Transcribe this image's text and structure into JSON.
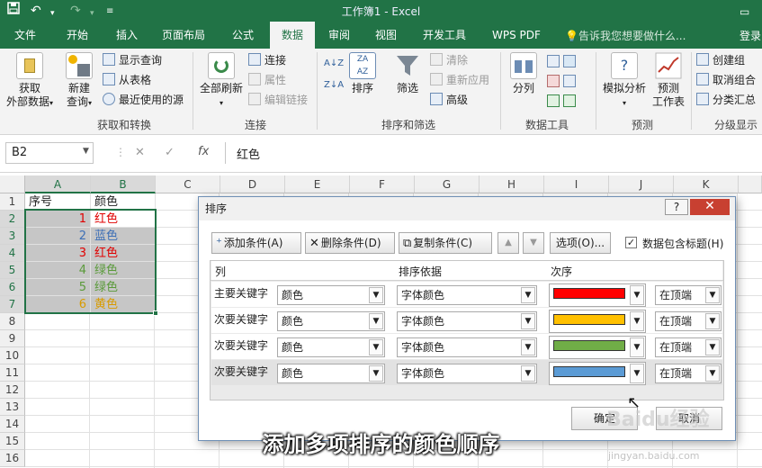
{
  "titlebar": {
    "save_icon": "save-icon",
    "undo_icon": "undo-icon",
    "redo_icon": "redo-icon",
    "qa_menu_icon": "customize-icon",
    "title": "工作簿1 - Excel"
  },
  "tabs": [
    "文件",
    "开始",
    "插入",
    "页面布局",
    "公式",
    "数据",
    "审阅",
    "视图",
    "开发工具",
    "WPS PDF"
  ],
  "active_tab": "数据",
  "tellme": "告诉我您想要做什么...",
  "login": "登录",
  "ribbon": {
    "get_external": "获取\n外部数据",
    "new_query": "新建\n查询",
    "show_query": "显示查询",
    "from_table": "从表格",
    "recent_sources": "最近使用的源",
    "group_get": "获取和转换",
    "refresh_all": "全部刷新",
    "connections": "连接",
    "properties": "属性",
    "edit_links": "编辑链接",
    "group_conn": "连接",
    "sort": "排序",
    "filter": "筛选",
    "clear": "清除",
    "reapply": "重新应用",
    "advanced": "高级",
    "group_sort": "排序和筛选",
    "text_to_cols": "分列",
    "group_tools": "数据工具",
    "what_if": "模拟分析",
    "forecast_sheet": "预测\n工作表",
    "group_forecast": "预测",
    "group_ungroup": "创建组",
    "ungroup": "取消组合",
    "subtotal": "分类汇总",
    "group_outline": "分级显示"
  },
  "formula_bar": {
    "name_box": "B2",
    "fx": "fx",
    "content": "红色"
  },
  "columns": [
    "A",
    "B",
    "C",
    "D",
    "E",
    "F",
    "G",
    "H",
    "I",
    "J",
    "K"
  ],
  "rows": [
    "1",
    "2",
    "3",
    "4",
    "5",
    "6",
    "7",
    "8",
    "9",
    "10",
    "11",
    "12",
    "13",
    "14",
    "15",
    "16"
  ],
  "cells": [
    {
      "a": "序号",
      "b": "颜色",
      "bcolor": "#222222",
      "acolor": "#222222"
    },
    {
      "a": "1",
      "b": "红色",
      "bcolor": "#e00000",
      "acolor": "#e00000"
    },
    {
      "a": "2",
      "b": "蓝色",
      "bcolor": "#3d6fb6",
      "acolor": "#3d6fb6"
    },
    {
      "a": "3",
      "b": "红色",
      "bcolor": "#e00000",
      "acolor": "#e00000"
    },
    {
      "a": "4",
      "b": "绿色",
      "bcolor": "#5a9a3a",
      "acolor": "#5a9a3a"
    },
    {
      "a": "5",
      "b": "绿色",
      "bcolor": "#5a9a3a",
      "acolor": "#5a9a3a"
    },
    {
      "a": "6",
      "b": "黄色",
      "bcolor": "#d89b00",
      "acolor": "#d89b00"
    }
  ],
  "dialog": {
    "title": "排序",
    "help": "?",
    "close": "✕",
    "add_level": "添加条件(A)",
    "delete_level": "删除条件(D)",
    "copy_level": "复制条件(C)",
    "move_up": "▲",
    "move_down": "▼",
    "options": "选项(O)...",
    "has_headers": "数据包含标题(H)",
    "has_headers_checked": "✓",
    "col_header": "列",
    "sorton_header": "排序依据",
    "order_header": "次序",
    "levels": [
      {
        "label": "主要关键字",
        "column": "颜色",
        "sort_on": "字体颜色",
        "color": "#ff0000",
        "position": "在顶端"
      },
      {
        "label": "次要关键字",
        "column": "颜色",
        "sort_on": "字体颜色",
        "color": "#ffc000",
        "position": "在顶端"
      },
      {
        "label": "次要关键字",
        "column": "颜色",
        "sort_on": "字体颜色",
        "color": "#70ad47",
        "position": "在顶端"
      },
      {
        "label": "次要关键字",
        "column": "颜色",
        "sort_on": "字体颜色",
        "color": "#5b9bd5",
        "position": "在顶端"
      }
    ],
    "ok": "确定",
    "cancel": "取消"
  },
  "caption": "添加多项排序的颜色顺序",
  "watermark": {
    "line1": "Baidu经验",
    "line2": "jingyan.baidu.com"
  }
}
